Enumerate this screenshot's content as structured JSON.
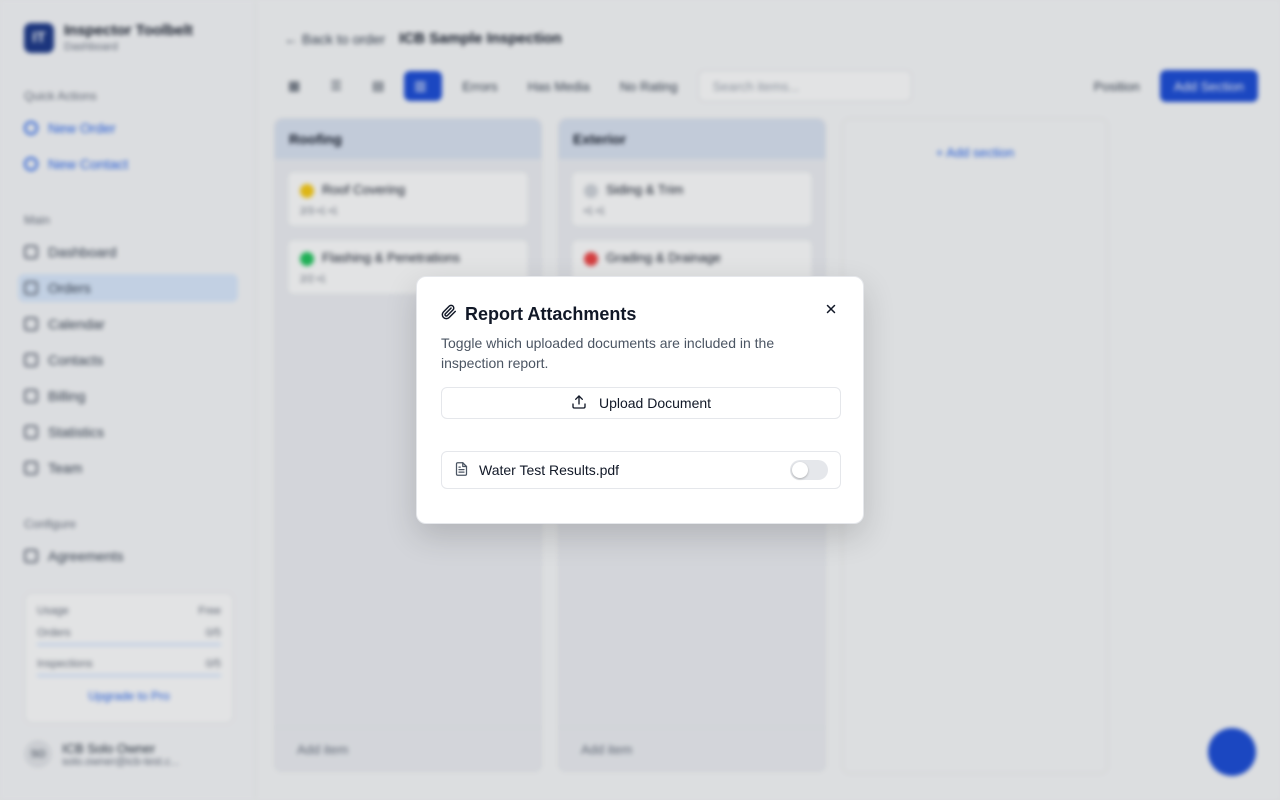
{
  "app": {
    "brand_name": "Inspector Toolbelt",
    "brand_sub": "Dashboard",
    "quick_actions_label": "Quick Actions",
    "quick_actions": [
      "New Order",
      "New Contact"
    ],
    "main_label": "Main",
    "nav": [
      "Dashboard",
      "Orders",
      "Calendar",
      "Contacts",
      "Billing",
      "Statistics",
      "Team"
    ],
    "configure_label": "Configure",
    "configure_items": [
      "Agreements"
    ],
    "usage": {
      "title": "Usage",
      "plan": "Free",
      "rows": [
        {
          "label": "Orders",
          "value": "0/5"
        },
        {
          "label": "Inspections",
          "value": "0/5"
        }
      ],
      "upgrade": "Upgrade to Pro"
    },
    "user": {
      "initials": "SO",
      "name": "ICB Solo Owner",
      "email": "solo.owner@icb-test.c..."
    }
  },
  "main": {
    "back": "Back to order",
    "title": "ICB Sample Inspection",
    "toolbar": {
      "errors": "Errors",
      "has_media": "Has Media",
      "no_rating": "No Rating",
      "search_placeholder": "Search items...",
      "position": "Position",
      "add_section": "Add Section"
    },
    "columns": [
      {
        "title": "Roofing",
        "items": [
          {
            "name": "Roof Covering",
            "meta": "2/3  ▪1  ▪1",
            "status_color": "#facc15"
          },
          {
            "name": "Flashing & Penetrations",
            "meta": "2/2  ▪1",
            "status_color": "#22c55e"
          }
        ],
        "add_item": "Add item"
      },
      {
        "title": "Exterior",
        "items": [
          {
            "name": "Siding & Trim",
            "meta": "▪1  ▪1",
            "status_color": "#d1d5db"
          },
          {
            "name": "Grading & Drainage",
            "meta": "",
            "status_color": "#ef4444"
          }
        ],
        "add_item": "Add item"
      }
    ],
    "add_section_placeholder": "Add section"
  },
  "dialog": {
    "title": "Report Attachments",
    "description": "Toggle which uploaded documents are included in the inspection report.",
    "upload_label": "Upload Document",
    "files": [
      {
        "name": "Water Test Results.pdf",
        "included": false
      }
    ]
  }
}
